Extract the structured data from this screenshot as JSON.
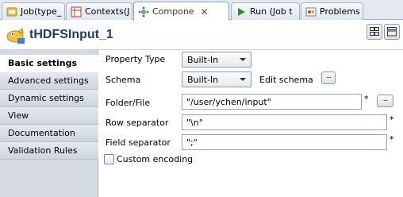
{
  "tabs": [
    {
      "label": "Job(type_",
      "icon": "job-icon"
    },
    {
      "label": "Contexts(J",
      "icon": "contexts-icon"
    },
    {
      "label": "Compone",
      "icon": "component-icon",
      "active": true
    },
    {
      "label": "Run (Job t",
      "icon": "run-icon"
    },
    {
      "label": "Problems",
      "icon": "problems-icon"
    }
  ],
  "header": {
    "title": "tHDFSInput_1",
    "icon": "hdfs-component-icon"
  },
  "nav": {
    "items": [
      {
        "label": "Basic settings",
        "active": true
      },
      {
        "label": "Advanced settings"
      },
      {
        "label": "Dynamic settings"
      },
      {
        "label": "View"
      },
      {
        "label": "Documentation"
      },
      {
        "label": "Validation Rules"
      }
    ]
  },
  "form": {
    "property_type": {
      "label": "Property Type",
      "value": "Built-In"
    },
    "schema": {
      "label": "Schema",
      "value": "Built-In",
      "edit_label": "Edit schema"
    },
    "folder_file": {
      "label": "Folder/File",
      "value": "\"/user/ychen/input\"",
      "required": "*"
    },
    "row_separator": {
      "label": "Row separator",
      "value": "\"\\n\"",
      "required": "*"
    },
    "field_separator": {
      "label": "Field separator",
      "value": "\";\"",
      "required": "*"
    },
    "custom_encoding": {
      "label": "Custom encoding",
      "checked": false
    },
    "browse_label": "..."
  },
  "colors": {
    "title": "#233a6b",
    "tab_border": "#a7b5c8",
    "nav_bg": "#d6dbe2"
  }
}
